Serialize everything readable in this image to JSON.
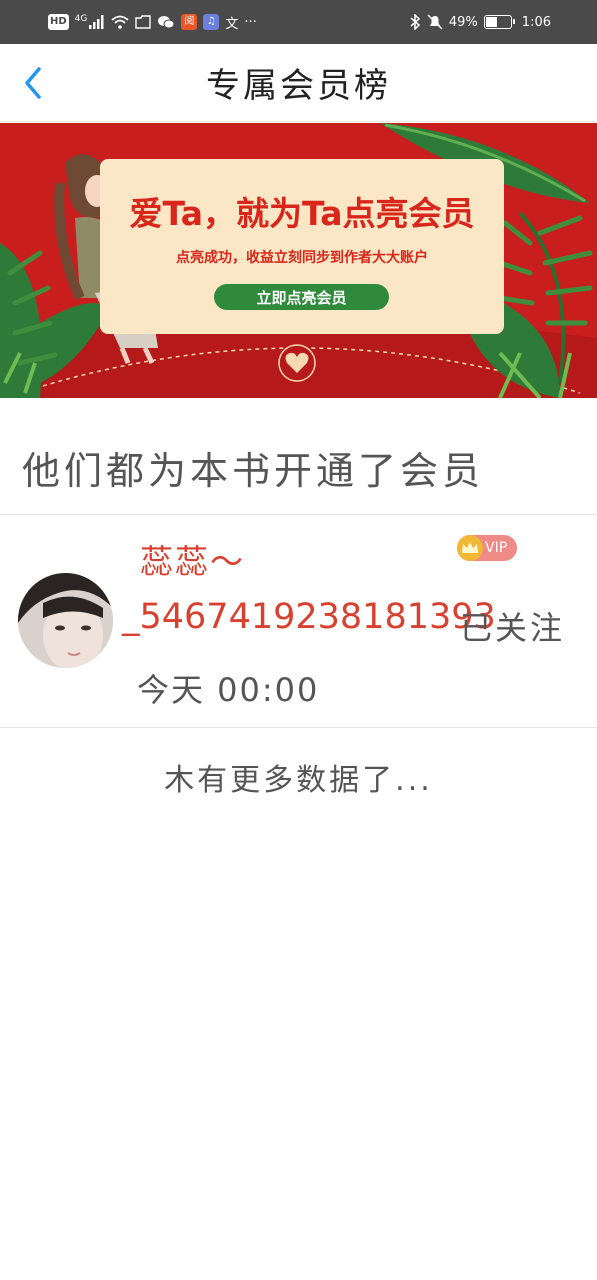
{
  "status_bar": {
    "hd": "HD",
    "network": "4G",
    "app1": "阅",
    "input_method": "文",
    "more": "···",
    "battery_text": "49%",
    "battery_level": 0.49,
    "time": "1:06"
  },
  "header": {
    "title": "专属会员榜",
    "back_icon": "chevron-left-icon"
  },
  "banner": {
    "headline": "爱Ta，就为Ta点亮会员",
    "subtitle": "点亮成功，收益立刻同步到作者大大账户",
    "button_label": "立即点亮会员",
    "colors": {
      "background": "#c81e1e",
      "card": "#fbe7c6",
      "button": "#2f8a3c",
      "text": "#d8261b"
    }
  },
  "section": {
    "title": "他们都为本书开通了会员"
  },
  "members": [
    {
      "name": "蕊蕊～",
      "vip_label": "VIP",
      "user_id": "_5467419238181393",
      "follow_status": "已关注",
      "time": "今天 00:00"
    }
  ],
  "footer": {
    "no_more": "木有更多数据了..."
  },
  "colors": {
    "accent_blue": "#2196f3",
    "name_red": "#d8412f",
    "vip_pink": "#f08a86",
    "crown_gold": "#f2b734"
  }
}
